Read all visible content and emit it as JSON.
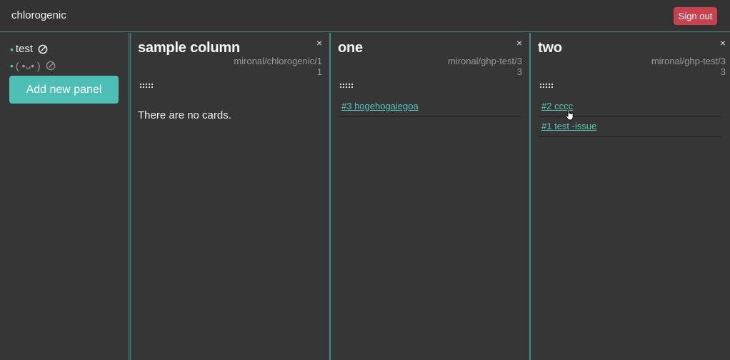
{
  "header": {
    "brand": "chlorogenic",
    "signout_label": "Sign out"
  },
  "sidebar": {
    "repos": [
      {
        "label": "test",
        "muted": false
      },
      {
        "label": "( •ᴗ• )",
        "muted": true
      }
    ],
    "add_panel_label": "Add new panel"
  },
  "columns": [
    {
      "title": "sample column",
      "source": "mironal/chlorogenic/1",
      "source_number": "1",
      "empty_text": "There are no cards.",
      "cards": []
    },
    {
      "title": "one",
      "source": "mironal/ghp-test/3",
      "source_number": "3",
      "empty_text": "",
      "cards": [
        {
          "label": "#3 hogehogaiegoa"
        }
      ]
    },
    {
      "title": "two",
      "source": "mironal/ghp-test/3",
      "source_number": "3",
      "empty_text": "",
      "cards": [
        {
          "label": "#2 cccc"
        },
        {
          "label": "#1 test -issue"
        }
      ]
    }
  ],
  "close_glyph": "×",
  "colors": {
    "accent": "#4dbfb4",
    "link": "#56c6ba",
    "signout": "#c9404e",
    "background": "#363636"
  }
}
